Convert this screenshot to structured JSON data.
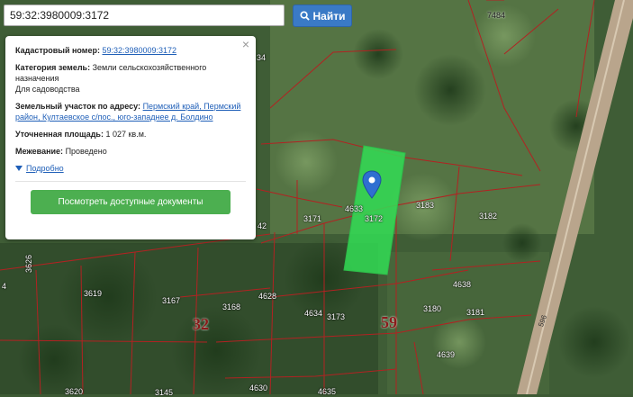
{
  "search": {
    "value": "59:32:3980009:3172",
    "button_label": "Найти"
  },
  "popup": {
    "cadastral_label": "Кадастровый номер:",
    "cadastral_value": "59:32:3980009:3172",
    "category_label": "Категория земель:",
    "category_value": "Земли сельскохозяйственного назначения",
    "category_sub": "Для садоводства",
    "address_label": "Земельный участок по адресу:",
    "address_value": "Пермский край, Пермский район, Култаевское с/пос., юго-западнее д. Болдино",
    "area_label": "Уточненная площадь:",
    "area_value": "1 027 кв.м.",
    "survey_label": "Межевание:",
    "survey_value": "Проведено",
    "details_label": "Подробно",
    "docs_button_label": "Посмотреть доступные документы",
    "close_symbol": "×"
  },
  "map": {
    "parcel_numbers": [
      "7484",
      "34",
      "42",
      "3171",
      "4633",
      "3172",
      "3183",
      "3182",
      "3626",
      "3619",
      "3167",
      "4628",
      "3168",
      "4634",
      "3173",
      "3180",
      "3181",
      "4638",
      "4639",
      "3620",
      "3145",
      "4630",
      "4635",
      "4"
    ],
    "block_numbers": [
      "32",
      "59"
    ],
    "road_number": "596",
    "colors": {
      "selected_parcel": "#33dd55",
      "boundary": "#b22222",
      "marker": "#2f6fd1"
    },
    "marker_icon": "map-pin-icon"
  }
}
